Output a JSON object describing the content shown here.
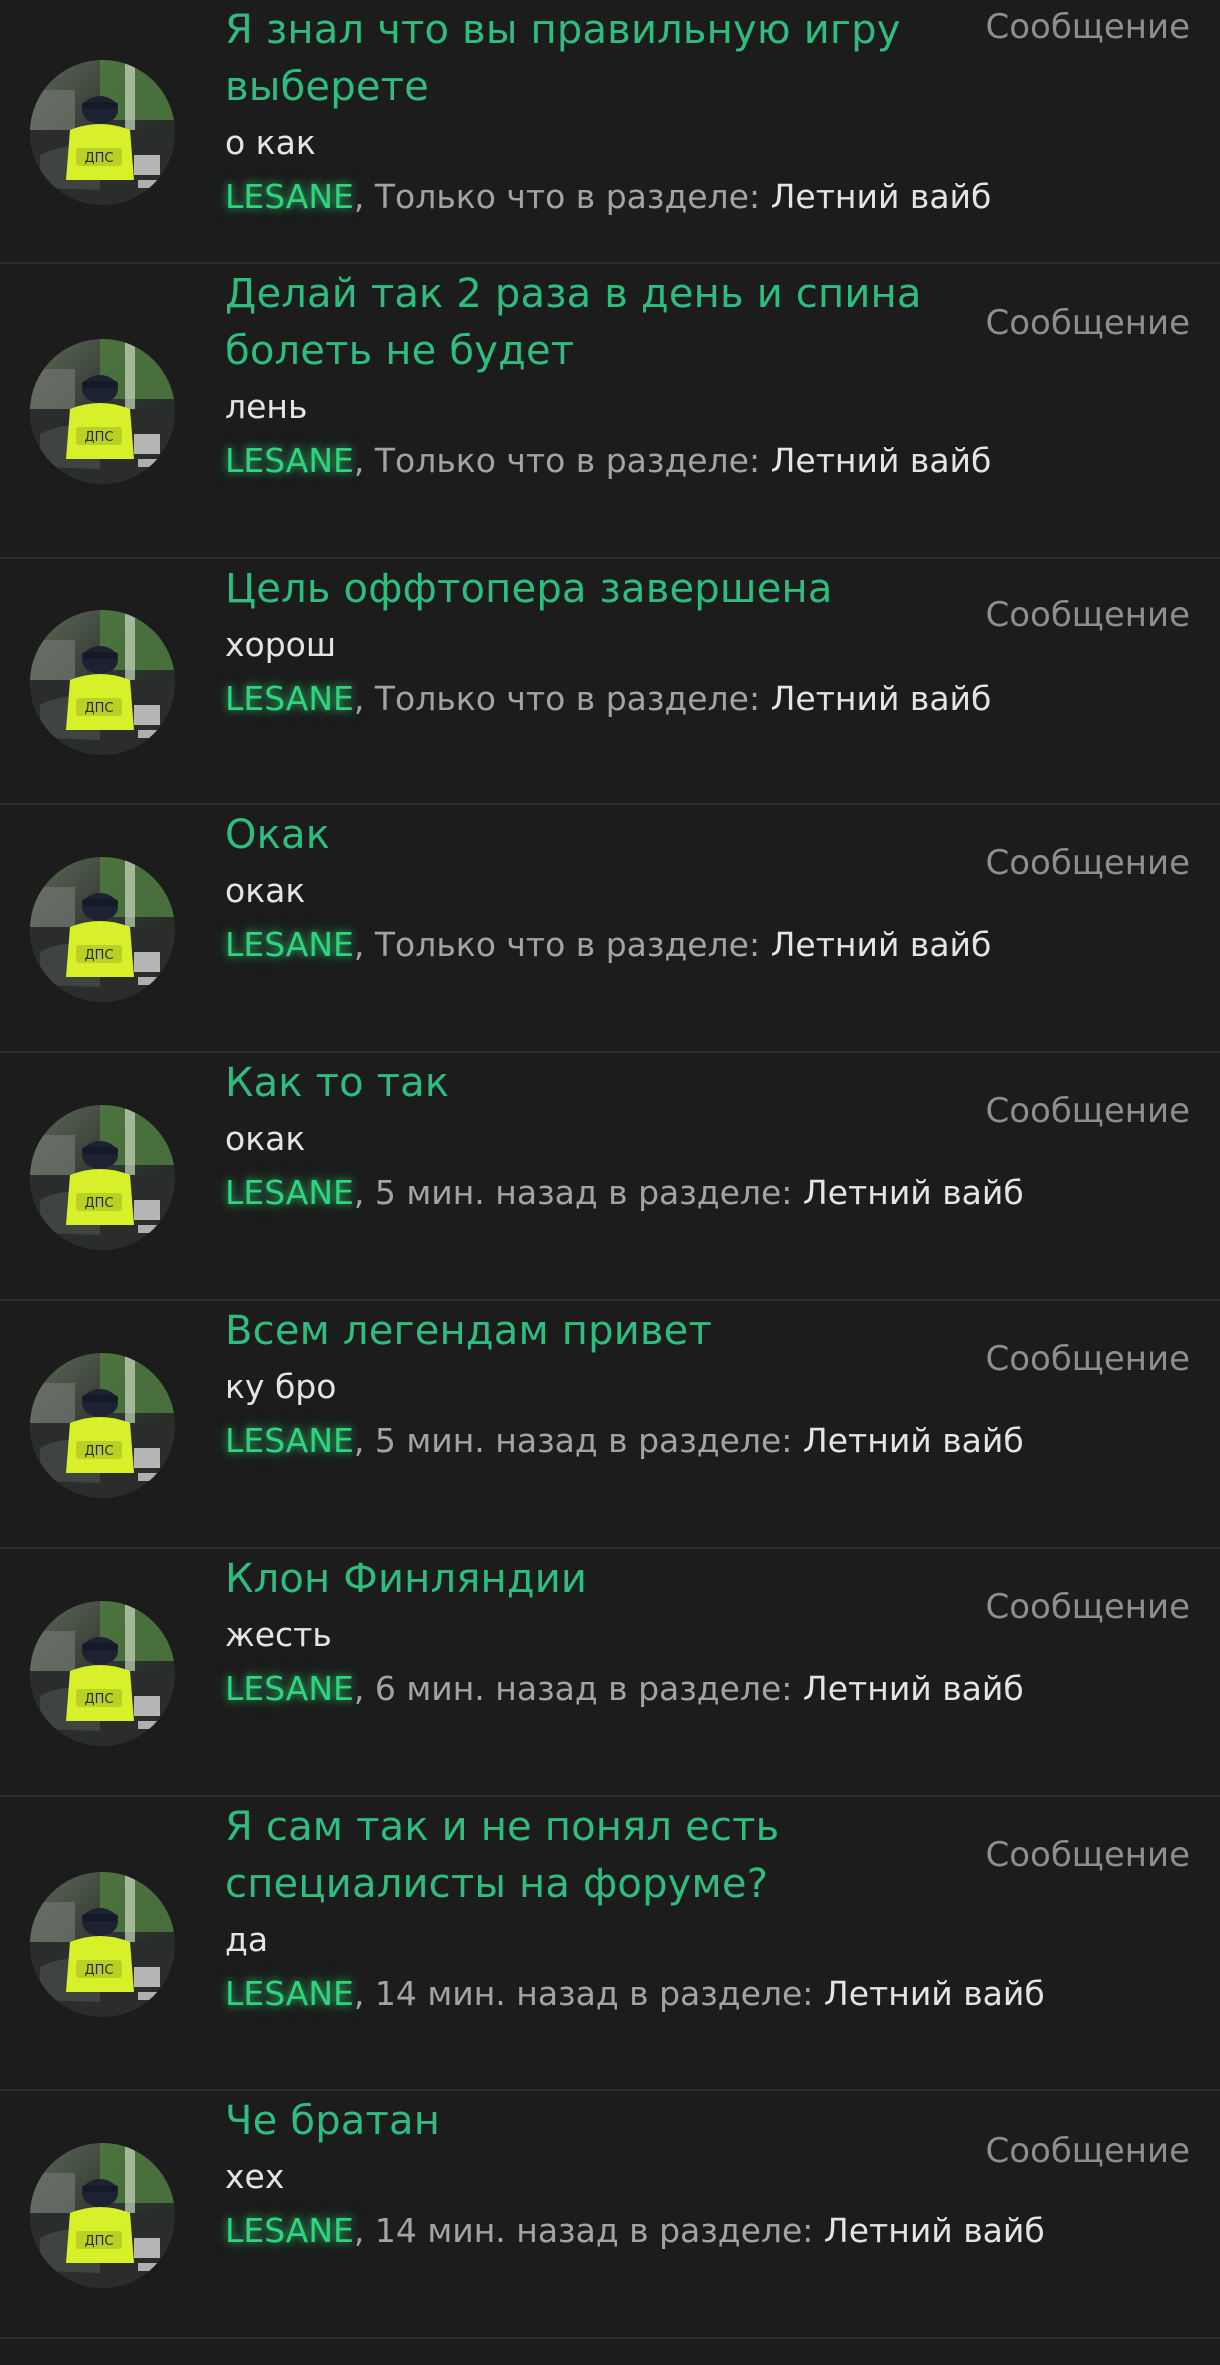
{
  "colors": {
    "background": "#1c1c1c",
    "title": "#2ebd7f",
    "author": "#2fd47c",
    "preview": "#e4e4e4",
    "meta": "#a3a3a3",
    "type_label": "#8e8e8e",
    "separator": "#2b2b2b"
  },
  "avatar_icon": "user-avatar-dps-officer",
  "feed": [
    {
      "title_lines": [
        "Я знал что вы правильную игру",
        "выберете"
      ],
      "preview": "о как",
      "author": "LESANE",
      "time": ", Только что в разделе: ",
      "section": "Летний вайб",
      "type": "Сообщение"
    },
    {
      "title_lines": [
        "Делай так 2 раза в день и спина",
        "болеть не будет"
      ],
      "preview": "лень",
      "author": "LESANE",
      "time": ", Только что в разделе: ",
      "section": "Летний вайб",
      "type": "Сообщение"
    },
    {
      "title_lines": [
        "Цель оффтопера завершена"
      ],
      "preview": "хорош",
      "author": "LESANE",
      "time": ", Только что в разделе: ",
      "section": "Летний вайб",
      "type": "Сообщение"
    },
    {
      "title_lines": [
        "Окак"
      ],
      "preview": "окак",
      "author": "LESANE",
      "time": ", Только что в разделе: ",
      "section": "Летний вайб",
      "type": "Сообщение"
    },
    {
      "title_lines": [
        "Как то так"
      ],
      "preview": "окак",
      "author": "LESANE",
      "time": ", 5 мин. назад в разделе: ",
      "section": "Летний вайб",
      "type": "Сообщение"
    },
    {
      "title_lines": [
        "Всем легендам привет"
      ],
      "preview": "ку бро",
      "author": "LESANE",
      "time": ", 5 мин. назад в разделе: ",
      "section": "Летний вайб",
      "type": "Сообщение"
    },
    {
      "title_lines": [
        "Клон Финляндии"
      ],
      "preview": "жесть",
      "author": "LESANE",
      "time": ", 6 мин. назад в разделе: ",
      "section": "Летний вайб",
      "type": "Сообщение"
    },
    {
      "title_lines": [
        "Я сам так и не понял есть",
        "специалисты на форуме?"
      ],
      "preview": "да",
      "author": "LESANE",
      "time": ", 14 мин. назад в разделе: ",
      "section": "Летний вайб",
      "type": "Сообщение"
    },
    {
      "title_lines": [
        "Че братан"
      ],
      "preview": "хех",
      "author": "LESANE",
      "time": ", 14 мин. назад в разделе: ",
      "section": "Летний вайб",
      "type": "Сообщение"
    }
  ]
}
